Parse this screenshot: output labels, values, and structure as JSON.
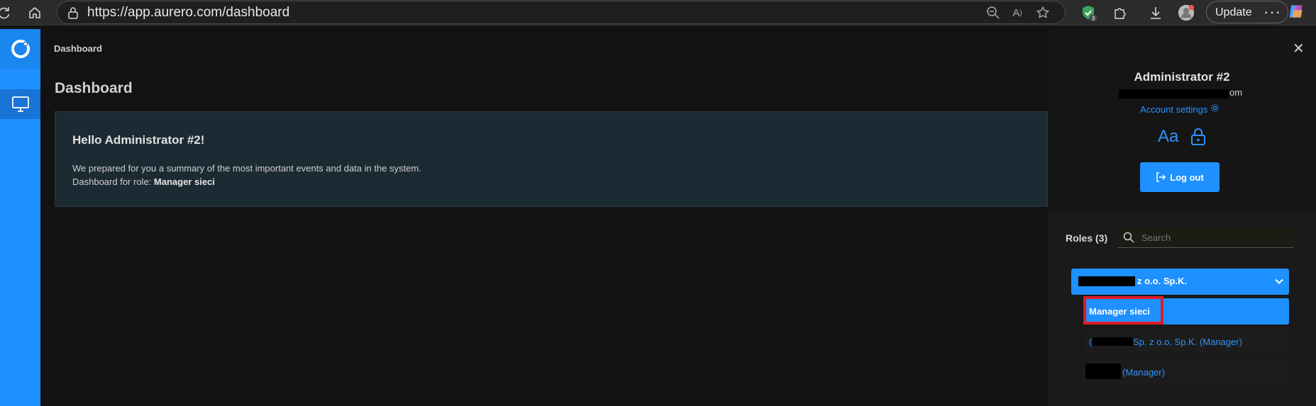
{
  "browser": {
    "url": "https://app.aurero.com/dashboard",
    "update_label": "Update",
    "more_label": "···",
    "extension_badge": "3"
  },
  "main": {
    "breadcrumb": "Dashboard",
    "page_title": "Dashboard",
    "welcome": {
      "title": "Hello Administrator #2!",
      "line1": "We prepared for you a summary of the most important events and data in the system.",
      "line2_prefix": "Dashboard for role: ",
      "line2_role": "Manager sieci"
    }
  },
  "panel": {
    "user_name": "Administrator #2",
    "email_tail": "om",
    "account_settings": "Account settings",
    "font_toggle": "Aa",
    "logout_label": "Log out",
    "roles_label": "Roles (3)",
    "search_placeholder": "Search",
    "group_label": "z o.o. Sp.K.",
    "roles": [
      {
        "label": "Manager sieci"
      },
      {
        "label": "Sp. z o.o. Sp.K. (Manager)"
      },
      {
        "label": "(Manager)"
      }
    ]
  },
  "colors": {
    "accent": "#1e90ff",
    "highlight": "#e01b24"
  }
}
